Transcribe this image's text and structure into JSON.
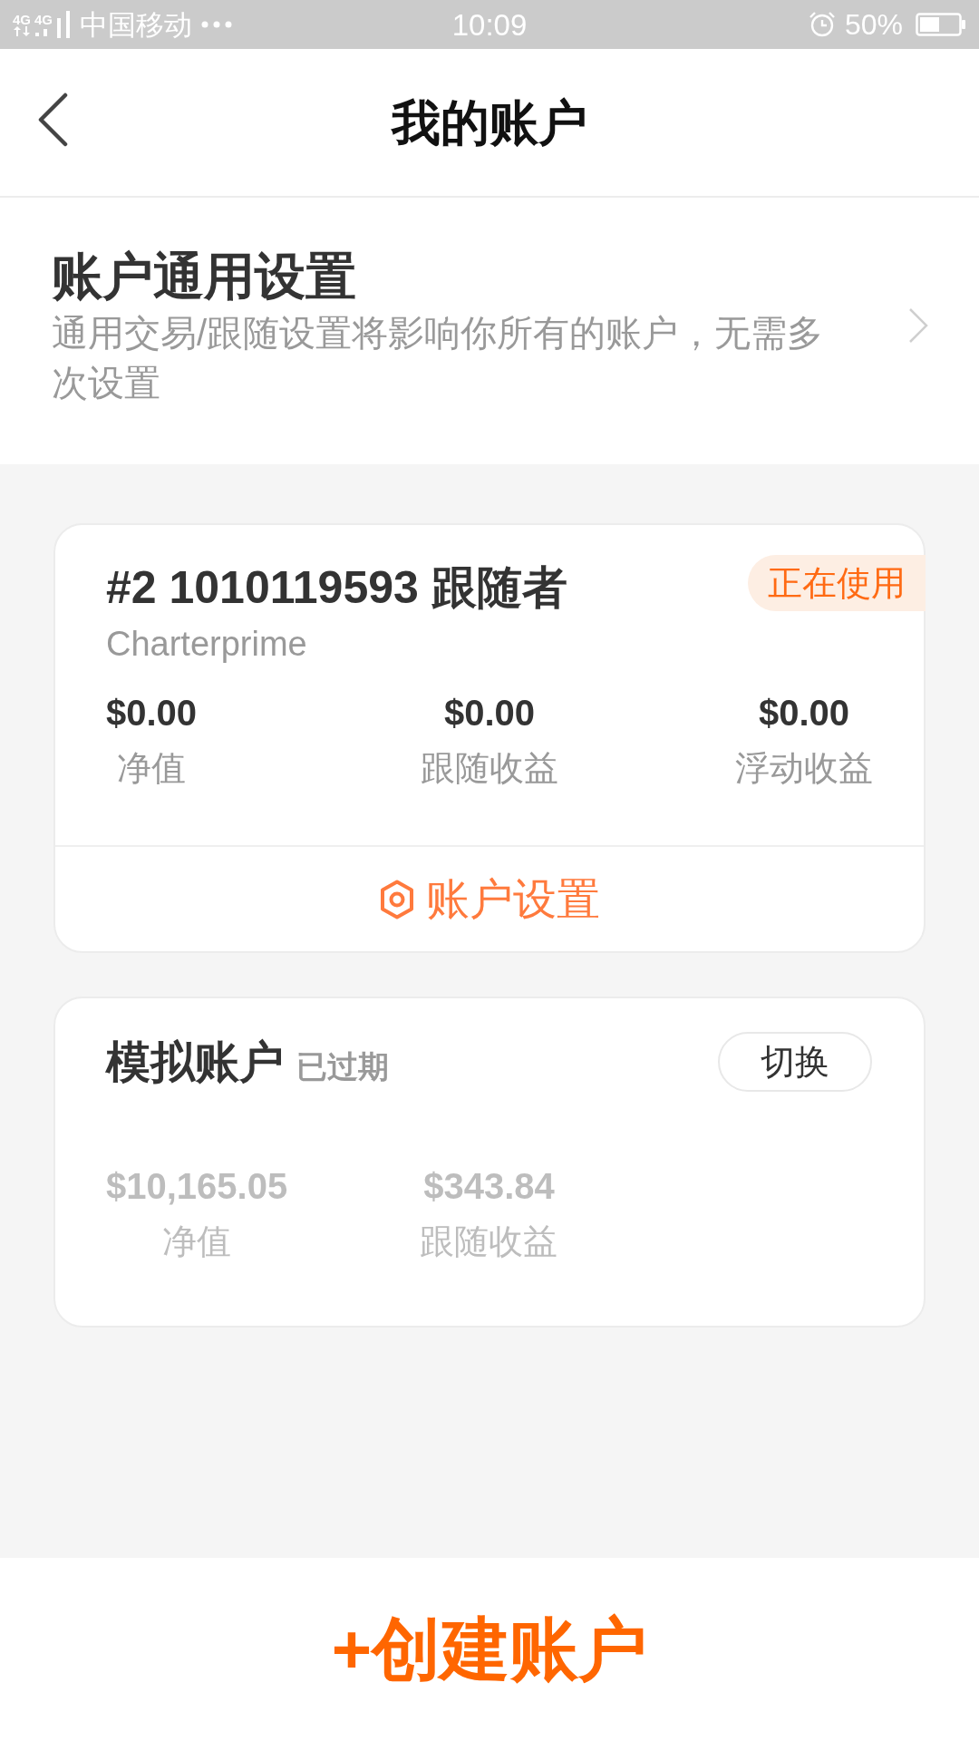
{
  "status_bar": {
    "network": [
      "4G",
      "4G"
    ],
    "carrier": "中国移动",
    "time": "10:09",
    "battery": "50%"
  },
  "header": {
    "title": "我的账户"
  },
  "general_settings": {
    "title": "账户通用设置",
    "description": "通用交易/跟随设置将影响你所有的账户，无需多次设置"
  },
  "accounts": [
    {
      "kind": "live",
      "title": "#2 1010119593 跟随者",
      "broker": "Charterprime",
      "badge": "正在使用",
      "expired": false,
      "stats": [
        {
          "value": "$0.00",
          "label": "净值"
        },
        {
          "value": "$0.00",
          "label": "跟随收益"
        },
        {
          "value": "$0.00",
          "label": "浮动收益"
        }
      ],
      "settings_button": "账户设置"
    },
    {
      "kind": "demo",
      "title": "模拟账户",
      "status": "已过期",
      "expired": true,
      "switch_button": "切换",
      "stats": [
        {
          "value": "$10,165.05",
          "label": "净值"
        },
        {
          "value": "$343.84",
          "label": "跟随收益"
        }
      ]
    }
  ],
  "create_button": "+创建账户"
}
